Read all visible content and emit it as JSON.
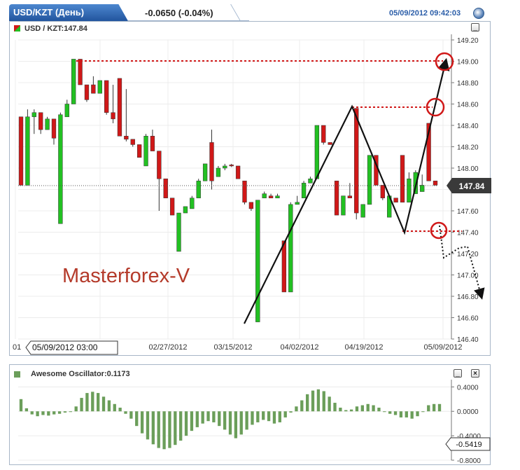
{
  "header": {
    "tab_title": "USD/KZT (День)",
    "change": "-0.0650 (-0.04%)",
    "timestamp": "05/09/2012 09:42:03"
  },
  "main_panel": {
    "title": "USD / KZT:147.84",
    "current_price_label": "147.84",
    "watermark": "Masterforex-V",
    "cursor_date": "05/09/2012 03:00",
    "minimize_label": "_"
  },
  "oscillator_panel": {
    "title": "Awesome Oscillator:0.1173",
    "current_value_label": "-0.5419",
    "minimize_label": "_",
    "close_label": "×"
  },
  "colors": {
    "up": "#22c022",
    "down": "#d01818",
    "oscillator": "#6b9e5a",
    "annotation": "#d01818"
  },
  "chart_data": [
    {
      "type": "candlestick",
      "title": "USD / KZT:147.84",
      "ylim": [
        146.4,
        149.2
      ],
      "yticks": [
        "149.20",
        "149.00",
        "148.80",
        "148.60",
        "148.40",
        "148.20",
        "148.00",
        "147.80",
        "147.60",
        "147.40",
        "147.20",
        "147.00",
        "146.80",
        "146.60",
        "146.40"
      ],
      "xticks": [
        "01",
        "02/27/2012",
        "03/15/2012",
        "04/02/2012",
        "04/19/2012",
        "05/09/2012"
      ],
      "last_price": 147.84,
      "candles": [
        {
          "o": 148.48,
          "h": 148.48,
          "l": 147.84,
          "c": 147.84
        },
        {
          "o": 147.84,
          "h": 148.55,
          "l": 147.84,
          "c": 148.48
        },
        {
          "o": 148.48,
          "h": 148.55,
          "l": 148.32,
          "c": 148.52
        },
        {
          "o": 148.52,
          "h": 148.52,
          "l": 148.32,
          "c": 148.36
        },
        {
          "o": 148.36,
          "h": 148.48,
          "l": 148.36,
          "c": 148.46
        },
        {
          "o": 148.46,
          "h": 148.46,
          "l": 148.22,
          "c": 148.28
        },
        {
          "o": 147.48,
          "h": 148.52,
          "l": 147.48,
          "c": 148.5
        },
        {
          "o": 148.48,
          "h": 148.64,
          "l": 148.48,
          "c": 148.6
        },
        {
          "o": 148.6,
          "h": 149.02,
          "l": 148.6,
          "c": 149.02
        },
        {
          "o": 149.02,
          "h": 149.02,
          "l": 148.78,
          "c": 148.78
        },
        {
          "o": 148.78,
          "h": 148.78,
          "l": 148.62,
          "c": 148.64
        },
        {
          "o": 148.78,
          "h": 148.86,
          "l": 148.7,
          "c": 148.7
        },
        {
          "o": 148.7,
          "h": 148.82,
          "l": 148.7,
          "c": 148.82
        },
        {
          "o": 148.82,
          "h": 148.82,
          "l": 148.5,
          "c": 148.52
        },
        {
          "o": 148.52,
          "h": 148.78,
          "l": 148.42,
          "c": 148.46
        },
        {
          "o": 148.84,
          "h": 148.84,
          "l": 148.3,
          "c": 148.3
        },
        {
          "o": 148.3,
          "h": 148.74,
          "l": 148.25,
          "c": 148.27
        },
        {
          "o": 148.27,
          "h": 148.27,
          "l": 148.2,
          "c": 148.22
        },
        {
          "o": 148.22,
          "h": 148.22,
          "l": 148.1,
          "c": 148.1
        },
        {
          "o": 148.02,
          "h": 148.32,
          "l": 148.02,
          "c": 148.3
        },
        {
          "o": 148.3,
          "h": 148.36,
          "l": 148.16,
          "c": 148.16
        },
        {
          "o": 148.16,
          "h": 148.16,
          "l": 147.6,
          "c": 147.9
        },
        {
          "o": 147.9,
          "h": 147.9,
          "l": 147.72,
          "c": 147.72
        },
        {
          "o": 147.72,
          "h": 147.72,
          "l": 147.56,
          "c": 147.56
        },
        {
          "o": 147.22,
          "h": 147.58,
          "l": 147.22,
          "c": 147.58
        },
        {
          "o": 147.58,
          "h": 147.64,
          "l": 147.58,
          "c": 147.64
        },
        {
          "o": 147.62,
          "h": 147.74,
          "l": 147.62,
          "c": 147.72
        },
        {
          "o": 147.72,
          "h": 147.9,
          "l": 147.72,
          "c": 147.88
        },
        {
          "o": 147.88,
          "h": 148.04,
          "l": 147.88,
          "c": 148.04
        },
        {
          "o": 148.24,
          "h": 148.36,
          "l": 147.8,
          "c": 147.88
        },
        {
          "o": 147.92,
          "h": 148.02,
          "l": 147.92,
          "c": 148.0
        },
        {
          "o": 148.0,
          "h": 148.04,
          "l": 147.98,
          "c": 148.02
        },
        {
          "o": 148.03,
          "h": 148.04,
          "l": 148.01,
          "c": 148.02
        },
        {
          "o": 148.02,
          "h": 148.02,
          "l": 147.9,
          "c": 147.9
        },
        {
          "o": 147.88,
          "h": 147.88,
          "l": 147.66,
          "c": 147.68
        },
        {
          "o": 147.68,
          "h": 147.68,
          "l": 147.6,
          "c": 147.62
        },
        {
          "o": 146.56,
          "h": 147.7,
          "l": 146.56,
          "c": 147.7
        },
        {
          "o": 147.72,
          "h": 147.78,
          "l": 147.72,
          "c": 147.76
        },
        {
          "o": 147.74,
          "h": 147.76,
          "l": 147.72,
          "c": 147.72
        },
        {
          "o": 147.72,
          "h": 147.76,
          "l": 147.72,
          "c": 147.74
        },
        {
          "o": 147.32,
          "h": 147.32,
          "l": 146.84,
          "c": 146.84
        },
        {
          "o": 146.84,
          "h": 147.68,
          "l": 146.84,
          "c": 147.66
        },
        {
          "o": 147.66,
          "h": 147.74,
          "l": 147.66,
          "c": 147.68
        },
        {
          "o": 147.72,
          "h": 147.88,
          "l": 147.72,
          "c": 147.86
        },
        {
          "o": 147.86,
          "h": 147.92,
          "l": 147.86,
          "c": 147.9
        },
        {
          "o": 147.9,
          "h": 148.4,
          "l": 147.9,
          "c": 148.4
        },
        {
          "o": 148.4,
          "h": 148.4,
          "l": 148.22,
          "c": 148.24
        },
        {
          "o": 148.24,
          "h": 148.24,
          "l": 148.22,
          "c": 148.22
        },
        {
          "o": 147.88,
          "h": 147.88,
          "l": 147.56,
          "c": 147.56
        },
        {
          "o": 147.56,
          "h": 147.74,
          "l": 147.56,
          "c": 147.74
        },
        {
          "o": 147.74,
          "h": 147.86,
          "l": 147.72,
          "c": 147.72
        },
        {
          "o": 148.56,
          "h": 148.56,
          "l": 147.52,
          "c": 147.58
        },
        {
          "o": 147.54,
          "h": 147.66,
          "l": 147.54,
          "c": 147.66
        },
        {
          "o": 147.66,
          "h": 148.12,
          "l": 147.66,
          "c": 148.12
        },
        {
          "o": 148.12,
          "h": 148.12,
          "l": 147.84,
          "c": 147.84
        },
        {
          "o": 147.84,
          "h": 147.84,
          "l": 147.7,
          "c": 147.72
        },
        {
          "o": 147.54,
          "h": 147.74,
          "l": 147.54,
          "c": 147.74
        },
        {
          "o": 147.72,
          "h": 147.72,
          "l": 147.68,
          "c": 147.68
        },
        {
          "o": 148.12,
          "h": 148.12,
          "l": 147.68,
          "c": 147.68
        },
        {
          "o": 147.68,
          "h": 147.96,
          "l": 147.68,
          "c": 147.9
        },
        {
          "o": 147.76,
          "h": 147.98,
          "l": 147.76,
          "c": 147.96
        },
        {
          "o": 147.78,
          "h": 147.94,
          "l": 147.78,
          "c": 147.84
        },
        {
          "o": 148.42,
          "h": 148.42,
          "l": 147.88,
          "c": 147.88
        },
        {
          "o": 147.88,
          "h": 147.88,
          "l": 147.84,
          "c": 147.84
        }
      ]
    },
    {
      "type": "bar",
      "title": "Awesome Oscillator:0.1173",
      "ylim": [
        -0.8,
        0.45
      ],
      "yticks": [
        "0.4000",
        "0.0000",
        "-0.4000",
        "-0.8000"
      ],
      "last_value": -0.5419,
      "values": [
        0.2,
        0.05,
        -0.05,
        -0.08,
        -0.06,
        -0.07,
        -0.05,
        -0.04,
        -0.02,
        0.0,
        0.08,
        0.22,
        0.3,
        0.32,
        0.3,
        0.24,
        0.18,
        0.12,
        0.06,
        -0.04,
        -0.12,
        -0.24,
        -0.36,
        -0.46,
        -0.54,
        -0.6,
        -0.62,
        -0.6,
        -0.55,
        -0.48,
        -0.4,
        -0.32,
        -0.26,
        -0.2,
        -0.16,
        -0.18,
        -0.24,
        -0.3,
        -0.38,
        -0.44,
        -0.38,
        -0.3,
        -0.22,
        -0.18,
        -0.14,
        -0.16,
        -0.2,
        -0.18,
        -0.1,
        -0.02,
        0.08,
        0.18,
        0.28,
        0.34,
        0.36,
        0.33,
        0.24,
        0.14,
        0.06,
        0.02,
        0.03,
        0.08,
        0.1,
        0.12,
        0.1,
        0.06,
        0.0,
        -0.04,
        -0.06,
        -0.1,
        -0.1,
        -0.12,
        -0.08,
        0.0,
        0.1,
        0.12,
        0.12
      ]
    }
  ]
}
